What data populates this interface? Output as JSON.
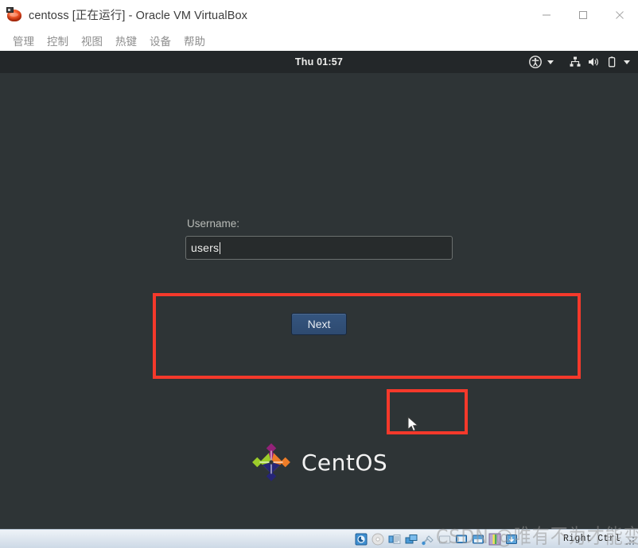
{
  "window": {
    "title": "centoss [正在运行] - Oracle VM VirtualBox",
    "icon": "virtualbox-icon",
    "controls": {
      "minimize": "minimize-button",
      "maximize": "maximize-button",
      "close": "close-button"
    }
  },
  "menubar": {
    "items": [
      {
        "label": "管理"
      },
      {
        "label": "控制"
      },
      {
        "label": "视图"
      },
      {
        "label": "热键"
      },
      {
        "label": "设备"
      },
      {
        "label": "帮助"
      }
    ]
  },
  "guest": {
    "topbar": {
      "clock": "Thu 01:57",
      "tray": [
        {
          "name": "accessibility-icon"
        },
        {
          "name": "chevron-down-icon"
        },
        {
          "name": "network-icon"
        },
        {
          "name": "volume-icon"
        },
        {
          "name": "battery-icon"
        },
        {
          "name": "chevron-down-icon"
        }
      ]
    },
    "login": {
      "username_label": "Username:",
      "username_value": "users",
      "username_placeholder": "",
      "next_label": "Next"
    },
    "branding": {
      "logo_text": "CentOS",
      "logo_colors": [
        "#9ccd2a",
        "#932279",
        "#262577",
        "#ef7d28"
      ]
    },
    "annotations": {
      "username_box_color": "#f5392b",
      "next_box_color": "#f5392b"
    }
  },
  "statusbar": {
    "icons": [
      {
        "name": "hard-disk-icon"
      },
      {
        "name": "optical-disk-icon"
      },
      {
        "name": "floppy-disk-icon"
      },
      {
        "name": "network-adapter-icon"
      },
      {
        "name": "usb-icon"
      },
      {
        "name": "shared-folder-icon"
      },
      {
        "name": "display-icon"
      },
      {
        "name": "recording-icon"
      },
      {
        "name": "mouse-integration-icon"
      },
      {
        "name": "keyboard-icon"
      }
    ],
    "host_key": "Right Ctrl"
  },
  "watermark": {
    "text": "CSDN @唯有不为才能变强"
  }
}
